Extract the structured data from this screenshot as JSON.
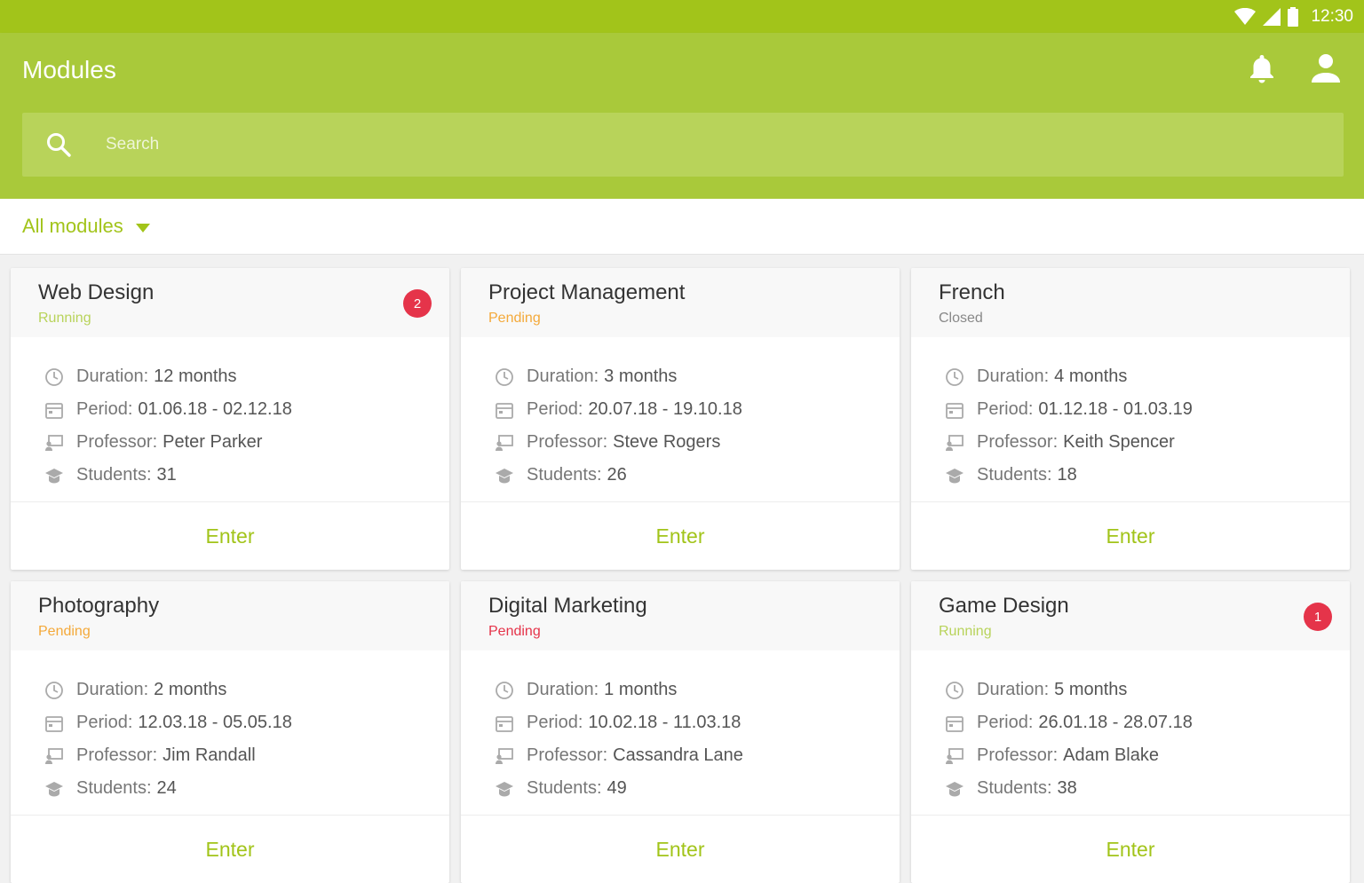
{
  "status_bar": {
    "time": "12:30"
  },
  "header": {
    "title": "Modules"
  },
  "search": {
    "placeholder": "Search"
  },
  "filter": {
    "label": "All modules"
  },
  "labels": {
    "duration": "Duration:",
    "period": "Period:",
    "professor": "Professor:",
    "students": "Students:",
    "enter": "Enter"
  },
  "colors": {
    "brand": "#a9c93a",
    "status_bar": "#a2c41a",
    "running": "#b8d35a",
    "pending": "#f4a93a",
    "pending_alt": "#e5344a",
    "closed": "#888888",
    "badge": "#e5344a"
  },
  "modules": [
    {
      "title": "Web Design",
      "status": "Running",
      "status_key": "running",
      "badge": "2",
      "duration": "12 months",
      "period": "01.06.18 - 02.12.18",
      "professor": "Peter Parker",
      "students": "31"
    },
    {
      "title": "Project Management",
      "status": "Pending",
      "status_key": "pending",
      "badge": "",
      "duration": "3 months",
      "period": "20.07.18 - 19.10.18",
      "professor": "Steve Rogers",
      "students": "26"
    },
    {
      "title": "French",
      "status": "Closed",
      "status_key": "closed",
      "badge": "",
      "duration": "4 months",
      "period": "01.12.18 - 01.03.19",
      "professor": "Keith Spencer",
      "students": "18"
    },
    {
      "title": "Photography",
      "status": "Pending",
      "status_key": "pending",
      "badge": "",
      "duration": "2 months",
      "period": "12.03.18 - 05.05.18",
      "professor": "Jim Randall",
      "students": "24"
    },
    {
      "title": "Digital Marketing",
      "status": "Pending",
      "status_key": "pending_alt",
      "badge": "",
      "duration": "1 months",
      "period": "10.02.18 - 11.03.18",
      "professor": "Cassandra Lane",
      "students": "49"
    },
    {
      "title": "Game Design",
      "status": "Running",
      "status_key": "running",
      "badge": "1",
      "duration": "5 months",
      "period": "26.01.18 - 28.07.18",
      "professor": "Adam Blake",
      "students": "38"
    }
  ]
}
